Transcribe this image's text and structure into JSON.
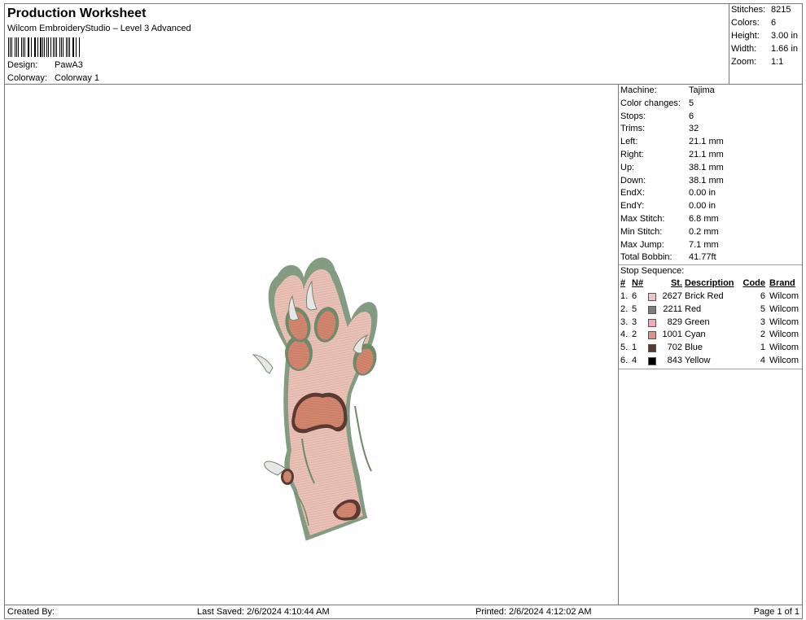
{
  "header": {
    "title": "Production Worksheet",
    "software": "Wilcom EmbroideryStudio – Level 3 Advanced",
    "design_label": "Design:",
    "design_value": "PawA3",
    "colorway_label": "Colorway:",
    "colorway_value": "Colorway 1"
  },
  "stats": [
    {
      "label": "Stitches:",
      "value": "8215"
    },
    {
      "label": "Colors:",
      "value": "6"
    },
    {
      "label": "Height:",
      "value": "3.00 in"
    },
    {
      "label": "Width:",
      "value": "1.66 in"
    },
    {
      "label": "Zoom:",
      "value": "1:1"
    }
  ],
  "machine_info": [
    {
      "label": "Machine:",
      "value": "Tajima"
    },
    {
      "label": "Color changes:",
      "value": "5"
    },
    {
      "label": "Stops:",
      "value": "6"
    },
    {
      "label": "Trims:",
      "value": "32"
    },
    {
      "label": "Left:",
      "value": "21.1 mm"
    },
    {
      "label": "Right:",
      "value": "21.1 mm"
    },
    {
      "label": "Up:",
      "value": "38.1 mm"
    },
    {
      "label": "Down:",
      "value": "38.1 mm"
    },
    {
      "label": "EndX:",
      "value": "0.00 in"
    },
    {
      "label": "EndY:",
      "value": "0.00 in"
    },
    {
      "label": "Max Stitch:",
      "value": "6.8 mm"
    },
    {
      "label": "Min Stitch:",
      "value": "0.2 mm"
    },
    {
      "label": "Max Jump:",
      "value": "7.1 mm"
    },
    {
      "label": "Total Bobbin:",
      "value": "41.77ft"
    }
  ],
  "stop_sequence": {
    "title": "Stop Sequence:",
    "columns": {
      "idx": "#",
      "n": "N#",
      "st": "St.",
      "description": "Description",
      "code": "Code",
      "brand": "Brand"
    },
    "rows": [
      {
        "idx": "1.",
        "n": "6",
        "color": "#f4c1c8",
        "st": "2627",
        "description": "Brick Red",
        "code": "6",
        "brand": "Wilcom"
      },
      {
        "idx": "2.",
        "n": "5",
        "color": "#7d7d7d",
        "st": "2211",
        "description": "Red",
        "code": "5",
        "brand": "Wilcom"
      },
      {
        "idx": "3.",
        "n": "3",
        "color": "#f5a8b8",
        "st": "829",
        "description": "Green",
        "code": "3",
        "brand": "Wilcom"
      },
      {
        "idx": "4.",
        "n": "2",
        "color": "#e08f8f",
        "st": "1001",
        "description": "Cyan",
        "code": "2",
        "brand": "Wilcom"
      },
      {
        "idx": "5.",
        "n": "1",
        "color": "#5a3a33",
        "st": "702",
        "description": "Blue",
        "code": "1",
        "brand": "Wilcom"
      },
      {
        "idx": "6.",
        "n": "4",
        "color": "#000000",
        "st": "843",
        "description": "Yellow",
        "code": "4",
        "brand": "Wilcom"
      }
    ]
  },
  "footer": {
    "created_by": "Created By:",
    "last_saved": "Last Saved: 2/6/2024 4:10:44 AM",
    "printed": "Printed: 2/6/2024 4:12:02 AM",
    "page": "Page 1 of 1"
  },
  "design_colors": {
    "base": "#e9c1b6",
    "outline": "#6e8a6a",
    "pad": "#d2866e",
    "pad_dark": "#5a3a33",
    "claw": "#e8e6e6"
  }
}
